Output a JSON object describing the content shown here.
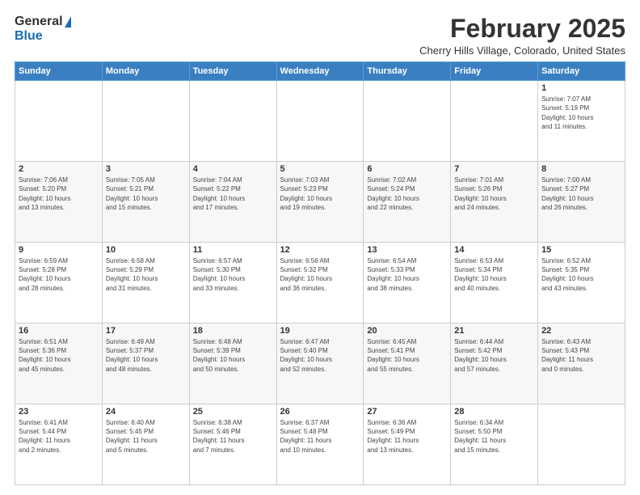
{
  "logo": {
    "general": "General",
    "blue": "Blue"
  },
  "title": {
    "month": "February 2025",
    "location": "Cherry Hills Village, Colorado, United States"
  },
  "weekdays": [
    "Sunday",
    "Monday",
    "Tuesday",
    "Wednesday",
    "Thursday",
    "Friday",
    "Saturday"
  ],
  "weeks": [
    [
      {
        "day": "",
        "info": ""
      },
      {
        "day": "",
        "info": ""
      },
      {
        "day": "",
        "info": ""
      },
      {
        "day": "",
        "info": ""
      },
      {
        "day": "",
        "info": ""
      },
      {
        "day": "",
        "info": ""
      },
      {
        "day": "1",
        "info": "Sunrise: 7:07 AM\nSunset: 5:19 PM\nDaylight: 10 hours\nand 11 minutes."
      }
    ],
    [
      {
        "day": "2",
        "info": "Sunrise: 7:06 AM\nSunset: 5:20 PM\nDaylight: 10 hours\nand 13 minutes."
      },
      {
        "day": "3",
        "info": "Sunrise: 7:05 AM\nSunset: 5:21 PM\nDaylight: 10 hours\nand 15 minutes."
      },
      {
        "day": "4",
        "info": "Sunrise: 7:04 AM\nSunset: 5:22 PM\nDaylight: 10 hours\nand 17 minutes."
      },
      {
        "day": "5",
        "info": "Sunrise: 7:03 AM\nSunset: 5:23 PM\nDaylight: 10 hours\nand 19 minutes."
      },
      {
        "day": "6",
        "info": "Sunrise: 7:02 AM\nSunset: 5:24 PM\nDaylight: 10 hours\nand 22 minutes."
      },
      {
        "day": "7",
        "info": "Sunrise: 7:01 AM\nSunset: 5:26 PM\nDaylight: 10 hours\nand 24 minutes."
      },
      {
        "day": "8",
        "info": "Sunrise: 7:00 AM\nSunset: 5:27 PM\nDaylight: 10 hours\nand 26 minutes."
      }
    ],
    [
      {
        "day": "9",
        "info": "Sunrise: 6:59 AM\nSunset: 5:28 PM\nDaylight: 10 hours\nand 28 minutes."
      },
      {
        "day": "10",
        "info": "Sunrise: 6:58 AM\nSunset: 5:29 PM\nDaylight: 10 hours\nand 31 minutes."
      },
      {
        "day": "11",
        "info": "Sunrise: 6:57 AM\nSunset: 5:30 PM\nDaylight: 10 hours\nand 33 minutes."
      },
      {
        "day": "12",
        "info": "Sunrise: 6:56 AM\nSunset: 5:32 PM\nDaylight: 10 hours\nand 36 minutes."
      },
      {
        "day": "13",
        "info": "Sunrise: 6:54 AM\nSunset: 5:33 PM\nDaylight: 10 hours\nand 38 minutes."
      },
      {
        "day": "14",
        "info": "Sunrise: 6:53 AM\nSunset: 5:34 PM\nDaylight: 10 hours\nand 40 minutes."
      },
      {
        "day": "15",
        "info": "Sunrise: 6:52 AM\nSunset: 5:35 PM\nDaylight: 10 hours\nand 43 minutes."
      }
    ],
    [
      {
        "day": "16",
        "info": "Sunrise: 6:51 AM\nSunset: 5:36 PM\nDaylight: 10 hours\nand 45 minutes."
      },
      {
        "day": "17",
        "info": "Sunrise: 6:49 AM\nSunset: 5:37 PM\nDaylight: 10 hours\nand 48 minutes."
      },
      {
        "day": "18",
        "info": "Sunrise: 6:48 AM\nSunset: 5:39 PM\nDaylight: 10 hours\nand 50 minutes."
      },
      {
        "day": "19",
        "info": "Sunrise: 6:47 AM\nSunset: 5:40 PM\nDaylight: 10 hours\nand 52 minutes."
      },
      {
        "day": "20",
        "info": "Sunrise: 6:45 AM\nSunset: 5:41 PM\nDaylight: 10 hours\nand 55 minutes."
      },
      {
        "day": "21",
        "info": "Sunrise: 6:44 AM\nSunset: 5:42 PM\nDaylight: 10 hours\nand 57 minutes."
      },
      {
        "day": "22",
        "info": "Sunrise: 6:43 AM\nSunset: 5:43 PM\nDaylight: 11 hours\nand 0 minutes."
      }
    ],
    [
      {
        "day": "23",
        "info": "Sunrise: 6:41 AM\nSunset: 5:44 PM\nDaylight: 11 hours\nand 2 minutes."
      },
      {
        "day": "24",
        "info": "Sunrise: 6:40 AM\nSunset: 5:45 PM\nDaylight: 11 hours\nand 5 minutes."
      },
      {
        "day": "25",
        "info": "Sunrise: 6:38 AM\nSunset: 5:46 PM\nDaylight: 11 hours\nand 7 minutes."
      },
      {
        "day": "26",
        "info": "Sunrise: 6:37 AM\nSunset: 5:48 PM\nDaylight: 11 hours\nand 10 minutes."
      },
      {
        "day": "27",
        "info": "Sunrise: 6:36 AM\nSunset: 5:49 PM\nDaylight: 11 hours\nand 13 minutes."
      },
      {
        "day": "28",
        "info": "Sunrise: 6:34 AM\nSunset: 5:50 PM\nDaylight: 11 hours\nand 15 minutes."
      },
      {
        "day": "",
        "info": ""
      }
    ]
  ]
}
